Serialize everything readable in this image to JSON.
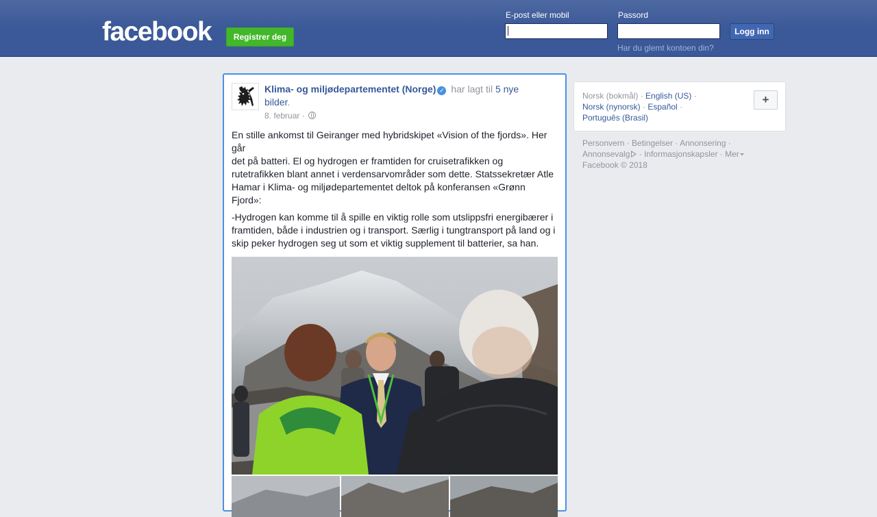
{
  "header": {
    "logo": "facebook",
    "register_label": "Registrer deg",
    "email_label": "E-post eller mobil",
    "password_label": "Passord",
    "login_label": "Logg inn",
    "forgot_label": "Har du glemt kontoen din?",
    "email_value": "",
    "password_value": ""
  },
  "post": {
    "page_name": "Klima- og miljødepartementet (Norge)",
    "verified_icon": "verified-check-icon",
    "action_text": "har lagt til",
    "photos_link": "5 nye bilder",
    "action_end": ".",
    "date": "8. februar",
    "date_sep": "·",
    "privacy_icon": "globe-icon",
    "paragraphs": [
      "En stille ankomst til Geiranger med hybridskipet «Vision of the fjords». Her går",
      "det på batteri. El og hydrogen er framtiden for cruisetrafikken og rutetrafikken blant annet i verdensarvområder som dette. Statssekretær Atle Hamar i Klima- og miljødepartementet deltok på konferansen «Grønn Fjord»:",
      "-Hydrogen kan komme til å spille en viktig rolle som utslippsfri energibærer i framtiden, både i industrien og i transport. Særlig i tungtransport på land og i skip peker hydrogen seg ut som et viktig supplement til batterier, sa han."
    ]
  },
  "languages": {
    "current": "Norsk (bokmål)",
    "options": [
      "English (US)",
      "Norsk (nynorsk)",
      "Español",
      "Português (Brasil)"
    ],
    "add_label": "+"
  },
  "footer": {
    "links": [
      "Personvern",
      "Betingelser",
      "Annonsering",
      "Annonsevalg",
      "Informasjonskapsler",
      "Mer"
    ],
    "copyright": "Facebook © 2018"
  },
  "colors": {
    "brand_blue": "#3b5998",
    "link_blue": "#365899",
    "register_green": "#42b72a",
    "focus_border": "#4a90e2"
  }
}
